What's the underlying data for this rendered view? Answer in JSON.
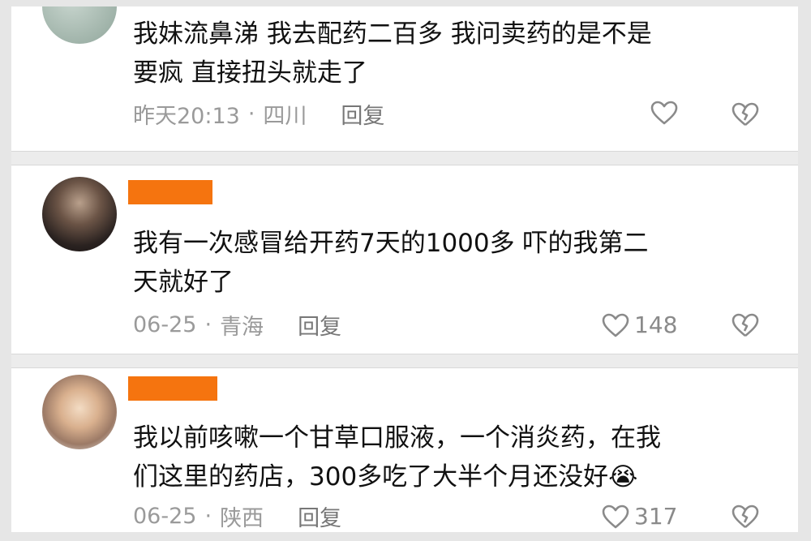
{
  "comments": [
    {
      "text_line1": "我妹流鼻涕 我去配药二百多 我问卖药的是不是",
      "text_line2": "要疯 直接扭头就走了",
      "time": "昨天20:13",
      "location": "四川",
      "reply_label": "回复",
      "likes": ""
    },
    {
      "text_line1": "我有一次感冒给开药7天的1000多   吓的我第二",
      "text_line2": "天就好了",
      "time": "06-25",
      "location": "青海",
      "reply_label": "回复",
      "likes": "148"
    },
    {
      "text_line1": "我以前咳嗽一个甘草口服液，一个消炎药，在我",
      "text_line2": "们这里的药店，300多吃了大半个月还没好😭",
      "time": "06-25",
      "location": "陕西",
      "reply_label": "回复",
      "likes": "317"
    }
  ],
  "meta_separator": "·",
  "colors": {
    "username_redaction": "#f5740f",
    "meta_text": "#9a9a9a",
    "body_text": "#111111",
    "separator": "#ececec"
  }
}
